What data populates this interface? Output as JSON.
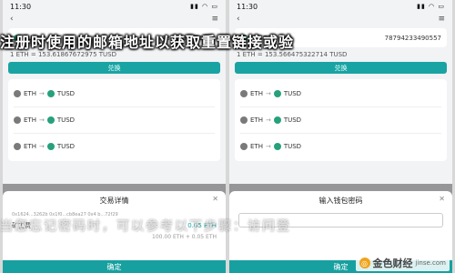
{
  "status": {
    "time": "11:30"
  },
  "left": {
    "pair_label": "TUSD",
    "balance": "7875533756866",
    "rate": "1 ETH = 153.61867672975 TUSD",
    "exchange_btn": "兑换",
    "list": [
      {
        "from": "ETH",
        "to": "TUSD"
      },
      {
        "from": "ETH",
        "to": "TUSD"
      },
      {
        "from": "ETH",
        "to": "TUSD"
      }
    ],
    "sheet": {
      "title": "交易详情",
      "address": "0x1624...3262b  0x1f0...cb8ea27  0x4 b...72f29",
      "fee_label": "矿工费",
      "fee": "0.05 ETH",
      "total": "100.00 ETH + 0.05 ETH",
      "confirm": "确定"
    }
  },
  "right": {
    "pair_label": "TUSD",
    "balance": "78794233490557",
    "rate": "1 ETH = 153.566475322714 TUSD",
    "exchange_btn": "兑换",
    "list": [
      {
        "from": "ETH",
        "to": "TUSD"
      },
      {
        "from": "ETH",
        "to": "TUSD"
      },
      {
        "from": "ETH",
        "to": "TUSD"
      }
    ],
    "sheet": {
      "title": "输入钱包密码",
      "confirm": "确定"
    }
  },
  "overlay_text": {
    "line1": "注册时使用的邮箱地址以获取重置链接或验",
    "line2": "当您忘记密码时，可以参考以下步骤：访问登"
  },
  "logo": {
    "text": "金色财经",
    "url": "jinse.com"
  }
}
